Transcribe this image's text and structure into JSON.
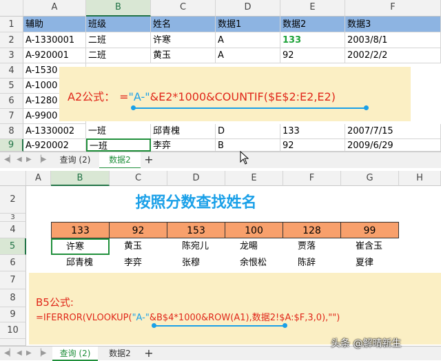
{
  "top": {
    "col_headers": [
      "A",
      "B",
      "C",
      "D",
      "E",
      "F"
    ],
    "row_numbers": [
      "1",
      "2",
      "3",
      "4",
      "5",
      "6",
      "7",
      "8",
      "9"
    ],
    "header_row": [
      "辅助",
      "班级",
      "姓名",
      "数据1",
      "数据2",
      "数据3"
    ],
    "rows": [
      [
        "A-1330001",
        "二班",
        "许寒",
        "A",
        "133",
        "2003/8/1"
      ],
      [
        "A-920001",
        "二班",
        "黄玉",
        "A",
        "92",
        "2002/2/2"
      ],
      [
        "A-1530",
        "",
        "",
        "",
        "",
        ""
      ],
      [
        "A-1000",
        "",
        "",
        "",
        "",
        ""
      ],
      [
        "A-1280",
        "",
        "",
        "",
        "",
        ""
      ],
      [
        "A-9900",
        "",
        "",
        "",
        "",
        ""
      ],
      [
        "A-1330002",
        "一班",
        "邱青槐",
        "D",
        "133",
        "2007/7/15"
      ],
      [
        "A-920002",
        "一班",
        "李弈",
        "B",
        "92",
        "2009/6/29"
      ]
    ],
    "formula_note": {
      "label": "A2公式：",
      "eq": "=",
      "part_a": "\"A-\"",
      "part_b": "&E2*1000",
      "part_c": "&COUNTIF($E$2:E2,E2)"
    },
    "tabs": [
      "查询 (2)",
      "数据2"
    ],
    "add_tab": "+"
  },
  "bottom": {
    "col_headers": [
      "A",
      "B",
      "C",
      "D",
      "E",
      "F",
      "G",
      "H"
    ],
    "row_numbers": [
      "2",
      "3",
      "4",
      "5",
      "6",
      "7",
      "8",
      "9",
      "10"
    ],
    "title": "按照分数查找姓名",
    "scores": [
      "133",
      "92",
      "153",
      "100",
      "128",
      "99"
    ],
    "names_row5": [
      "许寒",
      "黄玉",
      "陈宛儿",
      "龙暘",
      "贾落",
      "崔含玉"
    ],
    "names_row6": [
      "邱青槐",
      "李弈",
      "张穆",
      "余恨松",
      "陈辞",
      "夏律"
    ],
    "formula_note": {
      "label": "B5公式:",
      "part_a": "=IFERROR(VLOOKUP(",
      "part_b": "\"A-\"",
      "part_c": "&B$4*1000",
      "part_d": "&ROW(A1),数据2!$A:$F,3,0),\"\")"
    },
    "tabs": [
      "查询 (2)",
      "数据2"
    ],
    "add_tab": "+"
  },
  "watermark": "头条 @解晴新生",
  "colors": {
    "header_blue": "#8db4e2",
    "score_orange": "#f8a06c",
    "note_bg": "#fbefc4",
    "accent_green": "#1f8f3a",
    "formula_red": "#e0271a",
    "formula_blue": "#1aa0e8"
  }
}
